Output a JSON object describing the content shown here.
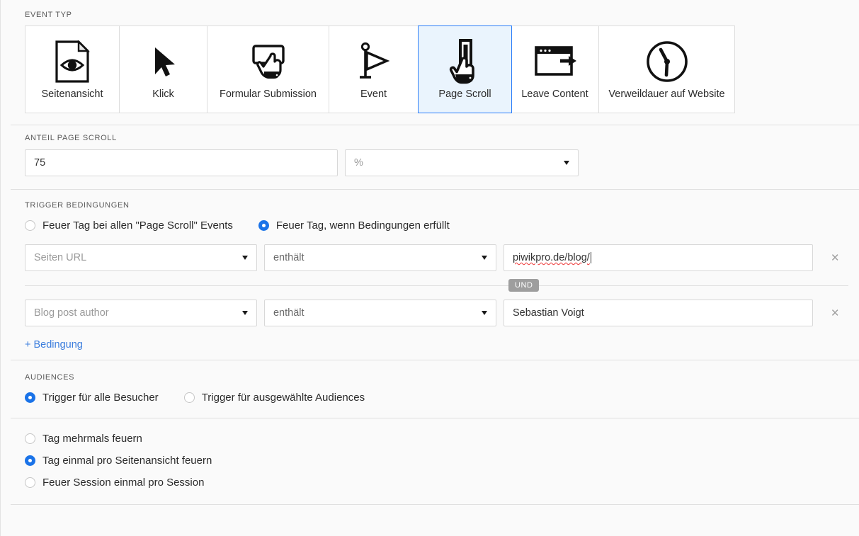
{
  "event_type": {
    "label": "EVENT TYP",
    "cards": [
      {
        "label": "Seitenansicht",
        "icon": "page-view-icon",
        "selected": false
      },
      {
        "label": "Klick",
        "icon": "cursor-arrow-icon",
        "selected": false
      },
      {
        "label": "Formular Submission",
        "icon": "form-submit-icon",
        "selected": false
      },
      {
        "label": "Event",
        "icon": "flag-icon",
        "selected": false
      },
      {
        "label": "Page Scroll",
        "icon": "page-scroll-icon",
        "selected": true
      },
      {
        "label": "Leave Content",
        "icon": "leave-content-icon",
        "selected": false
      },
      {
        "label": "Verweildauer auf Website",
        "icon": "clock-icon",
        "selected": false
      }
    ]
  },
  "scroll_amount": {
    "label": "ANTEIL PAGE SCROLL",
    "value": "75",
    "unit": "%"
  },
  "trigger_conditions": {
    "label": "TRIGGER BEDINGUNGEN",
    "mode_options": [
      {
        "label": "Feuer Tag bei allen \"Page Scroll\" Events",
        "selected": false
      },
      {
        "label": "Feuer Tag, wenn Bedingungen erfüllt",
        "selected": true
      }
    ],
    "and_badge": "UND",
    "add_link": "+ Bedingung",
    "rows": [
      {
        "field": "Seiten URL",
        "operator": "enthält",
        "value": "piwikpro.de/blog/",
        "remove": "×"
      },
      {
        "field": "Blog post author",
        "operator": "enthält",
        "value": "Sebastian Voigt",
        "remove": "×"
      }
    ]
  },
  "audiences": {
    "label": "AUDIENCES",
    "options": [
      {
        "label": "Trigger für alle Besucher",
        "selected": true
      },
      {
        "label": "Trigger für ausgewählte Audiences",
        "selected": false
      }
    ]
  },
  "fire_options": {
    "options": [
      {
        "label": "Tag mehrmals feuern",
        "selected": false
      },
      {
        "label": "Tag einmal pro Seitenansicht feuern",
        "selected": true
      },
      {
        "label": "Feuer Session einmal pro Session",
        "selected": false
      }
    ]
  },
  "colors": {
    "accent": "#1a73e8",
    "link": "#3b7ddd",
    "selected_card_bg": "#eaf4fd",
    "selected_card_border": "#2d7ff9",
    "badge_bg": "#9e9e9e"
  }
}
